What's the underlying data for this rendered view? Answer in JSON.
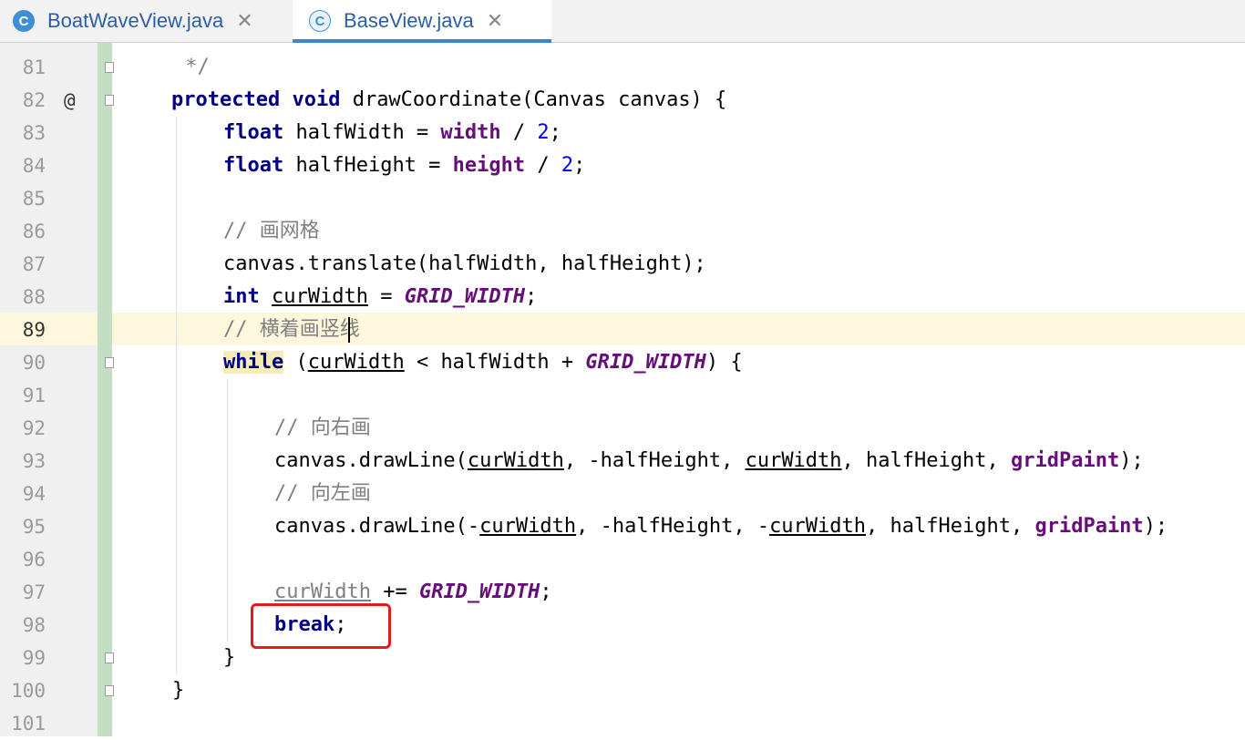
{
  "tabs": [
    {
      "icon_letter": "C",
      "label": "BoatWaveView.java",
      "close": "✕",
      "active": false
    },
    {
      "icon_letter": "C",
      "label": "BaseView.java",
      "close": "✕",
      "active": true
    }
  ],
  "editor": {
    "current_line": 89,
    "override_marker": "@",
    "lines": [
      {
        "n": "81"
      },
      {
        "n": "82"
      },
      {
        "n": "83"
      },
      {
        "n": "84"
      },
      {
        "n": "85"
      },
      {
        "n": "86"
      },
      {
        "n": "87"
      },
      {
        "n": "88"
      },
      {
        "n": "89"
      },
      {
        "n": "90"
      },
      {
        "n": "91"
      },
      {
        "n": "92"
      },
      {
        "n": "93"
      },
      {
        "n": "94"
      },
      {
        "n": "95"
      },
      {
        "n": "96"
      },
      {
        "n": "97"
      },
      {
        "n": "98"
      },
      {
        "n": "99"
      },
      {
        "n": "100"
      },
      {
        "n": "101"
      }
    ],
    "code": {
      "l81": " */",
      "l82_kw1": "protected",
      "l82_kw2": "void",
      "l82_rest": " drawCoordinate(Canvas canvas) {",
      "l83_kw": "float",
      "l83_a": " halfWidth = ",
      "l83_fld": "width",
      "l83_b": " / ",
      "l83_num": "2",
      "l83_c": ";",
      "l84_kw": "float",
      "l84_a": " halfHeight = ",
      "l84_fld": "height",
      "l84_b": " / ",
      "l84_num": "2",
      "l84_c": ";",
      "l86": "// 画网格",
      "l87": "canvas.translate(halfWidth, halfHeight);",
      "l88_kw": "int",
      "l88_var": "curWidth",
      "l88_a": " = ",
      "l88_cst": "GRID_WIDTH",
      "l88_b": ";",
      "l89": "// 横着画竖线",
      "l90_kw": "while",
      "l90_a": " (",
      "l90_var": "curWidth",
      "l90_b": " < halfWidth + ",
      "l90_cst": "GRID_WIDTH",
      "l90_c": ") {",
      "l92": "// 向右画",
      "l93_a": "canvas.drawLine(",
      "l93_v1": "curWidth",
      "l93_b": ", -halfHeight, ",
      "l93_v2": "curWidth",
      "l93_c": ", halfHeight, ",
      "l93_fld": "gridPaint",
      "l93_d": ");",
      "l94": "// 向左画",
      "l95_a": "canvas.drawLine(-",
      "l95_v1": "curWidth",
      "l95_b": ", -halfHeight, -",
      "l95_v2": "curWidth",
      "l95_c": ", halfHeight, ",
      "l95_fld": "gridPaint",
      "l95_d": ");",
      "l97_var": "curWidth",
      "l97_a": " += ",
      "l97_cst": "GRID_WIDTH",
      "l97_b": ";",
      "l98_kw": "break",
      "l98_a": ";",
      "l99": "}",
      "l100": "}"
    }
  },
  "colors": {
    "keyword": "#000080",
    "field": "#660e7a",
    "number": "#0000ff",
    "comment": "#808080",
    "highlight_box": "#e31b1b",
    "current_line": "#fdf8dd",
    "vcs_added": "#c4dec4"
  }
}
